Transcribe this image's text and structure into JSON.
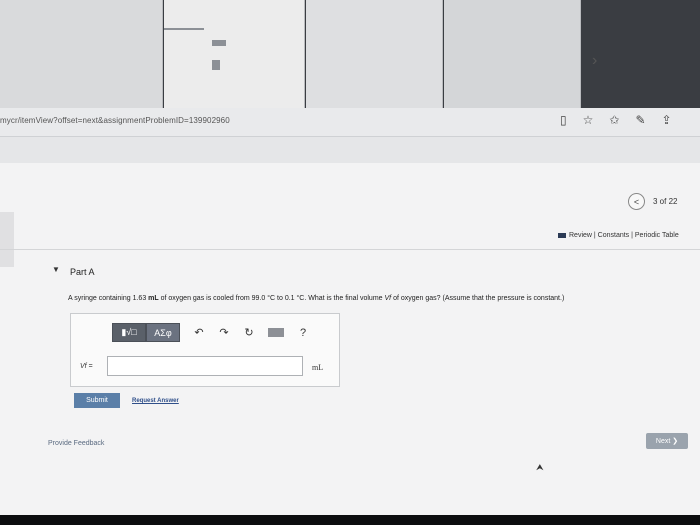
{
  "browser": {
    "url": "mycr/itemView?offset=next&assignmentProblemID=139902960",
    "icons": [
      "reader-icon",
      "star-icon",
      "favorites-icon",
      "pen-icon",
      "share-icon"
    ]
  },
  "pager": {
    "prev_icon": "<",
    "position": "3 of 22"
  },
  "links": {
    "review": "Review | Constants | Periodic Table"
  },
  "part": {
    "title": "Part A",
    "question_prefix": "A syringe containing 1.63 ",
    "unit_mL": "mL",
    "question_mid": " of oxygen gas is cooled from 99.0 °C to 0.1 °C. What is the final volume ",
    "var_symbol": "Vf",
    "question_suffix": " of oxygen gas? (Assume that the pressure is constant.)"
  },
  "answer": {
    "toolbar": {
      "template_btn": "▮√□",
      "greek_btn": "ΑΣφ",
      "undo": "↶",
      "redo": "↷",
      "reset": "↻",
      "keyboard": "▭",
      "help": "?"
    },
    "var_label": "Vf =",
    "input_value": "",
    "input_placeholder": "",
    "unit": "mL"
  },
  "actions": {
    "submit": "Submit",
    "request": "Request Answer",
    "feedback": "Provide Feedback",
    "next": "Next ❯"
  }
}
